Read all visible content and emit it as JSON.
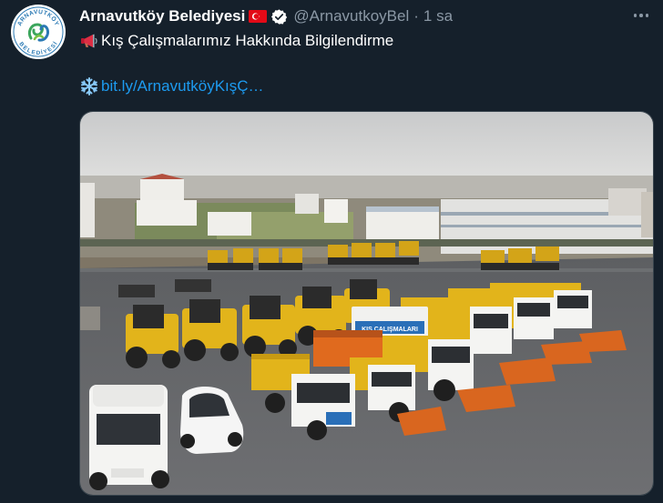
{
  "tweet": {
    "author": {
      "display_name": "Arnavutköy Belediyesi",
      "handle": "@ArnavutkoyBel",
      "avatar_icon": "municipality-logo",
      "avatar_top_text": "ARNAVUTKÖY",
      "avatar_bottom_text": "BELEDİYESİ",
      "flag_icon": "turkish-flag-icon",
      "verified_icon": "verified-badge-icon"
    },
    "separator": "·",
    "timestamp": "1 sa",
    "more_icon": "more-options-icon",
    "text_line1": "Kış Çalışmalarımız Hakkında Bilgilendirme",
    "line1_icon": "megaphone-icon",
    "line2_icon": "snowflake-icon",
    "link_text": "bit.ly/ArnavutköyKışÇ…",
    "media": {
      "type": "photo",
      "alt": "snow-plow-trucks-and-backhoe-loaders-photo",
      "truck_sign": "KIŞ ÇALIŞMALARI"
    }
  },
  "colors": {
    "background": "#15202b",
    "text_primary": "#ffffff",
    "text_secondary": "#8b98a5",
    "link": "#1d9bf0",
    "verified": "#ffffff",
    "flag_red": "#e30a17"
  }
}
